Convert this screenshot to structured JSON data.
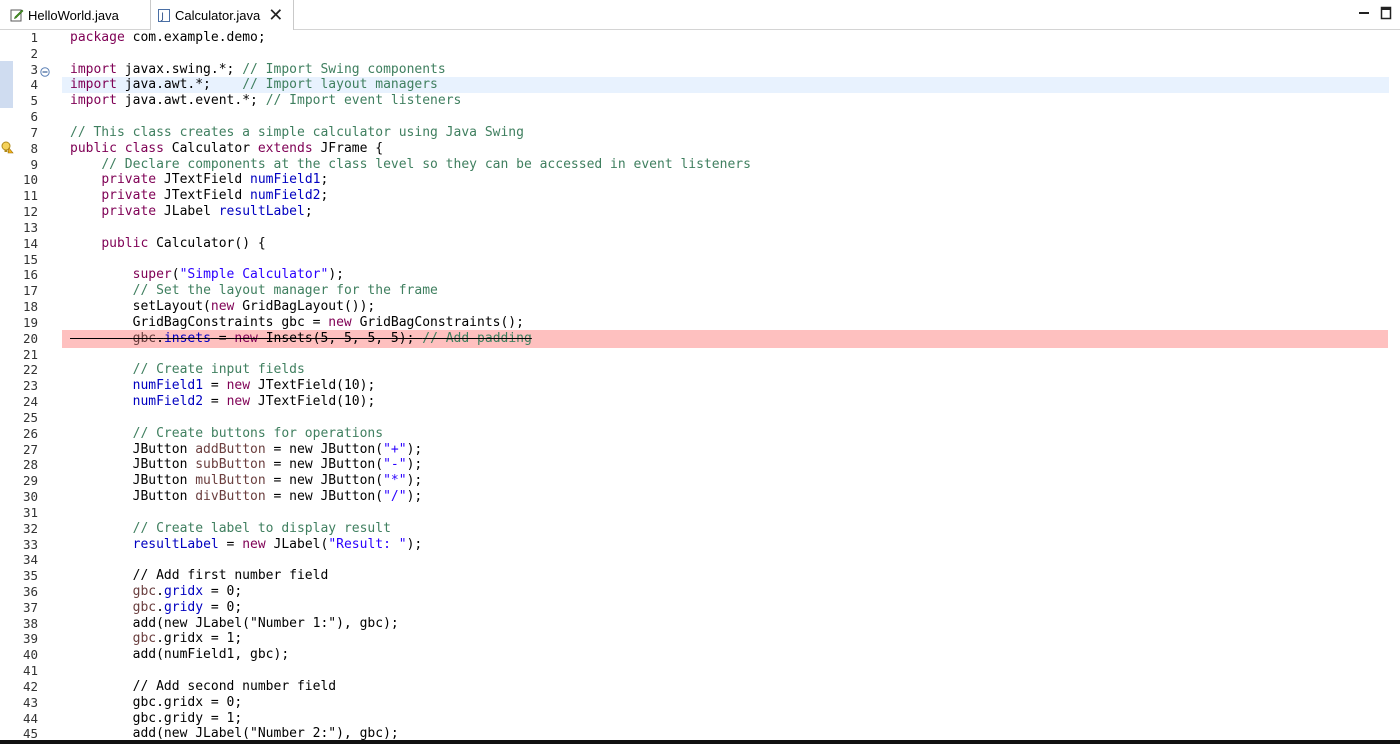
{
  "tabs": [
    {
      "label": "HelloWorld.java",
      "icon": "java-file-edit-icon",
      "active": false
    },
    {
      "label": "Calculator.java",
      "icon": "java-file-icon",
      "active": true
    }
  ],
  "colors": {
    "keyword": "#7f0055",
    "comment": "#3f7f5f",
    "string": "#2a00ff",
    "field": "#0000c0",
    "local": "#6a3e3e",
    "current_line": "#e8f2fe",
    "deleted_line": "#fec0bf"
  },
  "editor": {
    "line_numbers": [
      "1",
      "2",
      "3",
      "4",
      "5",
      "6",
      "7",
      "8",
      "9",
      "10",
      "11",
      "12",
      "13",
      "14",
      "15",
      "16",
      "17",
      "18",
      "19",
      "20",
      "21",
      "22",
      "23",
      "24",
      "25",
      "26",
      "27",
      "28",
      "29",
      "30",
      "31",
      "32",
      "33",
      "34",
      "35",
      "36",
      "37",
      "38",
      "39",
      "40",
      "41",
      "42",
      "43",
      "44",
      "45"
    ],
    "lines": [
      [
        [
          "kw",
          "package"
        ],
        [
          "p",
          " com.example.demo;"
        ]
      ],
      [],
      [
        [
          "kw",
          "import"
        ],
        [
          "p",
          " javax.swing.*; "
        ],
        [
          "cm",
          "// Import Swing components"
        ]
      ],
      [
        [
          "kw",
          "import"
        ],
        [
          "p",
          " java.awt.*;    "
        ],
        [
          "cm",
          "// Import layout managers"
        ]
      ],
      [
        [
          "kw",
          "import"
        ],
        [
          "p",
          " java.awt.event.*; "
        ],
        [
          "cm",
          "// Import event listeners"
        ]
      ],
      [],
      [
        [
          "cm",
          "// This class creates a simple calculator using Java Swing"
        ]
      ],
      [
        [
          "kw",
          "public"
        ],
        [
          "p",
          " "
        ],
        [
          "kw",
          "class"
        ],
        [
          "p",
          " Calculator "
        ],
        [
          "kw",
          "extends"
        ],
        [
          "p",
          " JFrame {"
        ]
      ],
      [
        [
          "p",
          "    "
        ],
        [
          "cm",
          "// Declare components at the class level so they can be accessed in event listeners"
        ]
      ],
      [
        [
          "p",
          "    "
        ],
        [
          "kw",
          "private"
        ],
        [
          "p",
          " JTextField "
        ],
        [
          "fd",
          "numField1"
        ],
        [
          "p",
          ";"
        ]
      ],
      [
        [
          "p",
          "    "
        ],
        [
          "kw",
          "private"
        ],
        [
          "p",
          " JTextField "
        ],
        [
          "fd",
          "numField2"
        ],
        [
          "p",
          ";"
        ]
      ],
      [
        [
          "p",
          "    "
        ],
        [
          "kw",
          "private"
        ],
        [
          "p",
          " JLabel "
        ],
        [
          "fd",
          "resultLabel"
        ],
        [
          "p",
          ";"
        ]
      ],
      [],
      [
        [
          "p",
          "    "
        ],
        [
          "kw",
          "public"
        ],
        [
          "p",
          " Calculator() {"
        ]
      ],
      [],
      [
        [
          "p",
          "        "
        ],
        [
          "kw",
          "super"
        ],
        [
          "p",
          "("
        ],
        [
          "st",
          "\"Simple Calculator\""
        ],
        [
          "p",
          ");"
        ]
      ],
      [
        [
          "p",
          "        "
        ],
        [
          "cm",
          "// Set the layout manager for the frame"
        ]
      ],
      [
        [
          "p",
          "        setLayout("
        ],
        [
          "kw",
          "new"
        ],
        [
          "p",
          " GridBagLayout());"
        ]
      ],
      [
        [
          "p",
          "        GridBagConstraints gbc = "
        ],
        [
          "kw",
          "new"
        ],
        [
          "p",
          " GridBagConstraints();"
        ]
      ],
      [
        [
          "p",
          "        "
        ],
        [
          "lv",
          "gbc"
        ],
        [
          "p",
          "."
        ],
        [
          "fd",
          "insets"
        ],
        [
          "p",
          " = "
        ],
        [
          "kw",
          "new"
        ],
        [
          "p",
          " Insets(5, 5, 5, 5); "
        ],
        [
          "cm",
          "// Add padding"
        ]
      ],
      [],
      [
        [
          "p",
          "        "
        ],
        [
          "cm",
          "// Create input fields"
        ]
      ],
      [
        [
          "p",
          "        "
        ],
        [
          "fd",
          "numField1"
        ],
        [
          "p",
          " = "
        ],
        [
          "kw",
          "new"
        ],
        [
          "p",
          " JTextField(10);"
        ]
      ],
      [
        [
          "p",
          "        "
        ],
        [
          "fd",
          "numField2"
        ],
        [
          "p",
          " = "
        ],
        [
          "kw",
          "new"
        ],
        [
          "p",
          " JTextField(10);"
        ]
      ],
      [],
      [
        [
          "p",
          "        "
        ],
        [
          "cm",
          "// Create buttons for operations"
        ]
      ],
      [
        [
          "p",
          "        JButton "
        ],
        [
          "lv",
          "addButton"
        ],
        [
          "p",
          " = new JButton("
        ],
        [
          "st",
          "\"+\""
        ],
        [
          "p",
          ");"
        ]
      ],
      [
        [
          "p",
          "        JButton "
        ],
        [
          "lv",
          "subButton"
        ],
        [
          "p",
          " = new JButton("
        ],
        [
          "st",
          "\"-\""
        ],
        [
          "p",
          ");"
        ]
      ],
      [
        [
          "p",
          "        JButton "
        ],
        [
          "lv",
          "mulButton"
        ],
        [
          "p",
          " = new JButton("
        ],
        [
          "st",
          "\"*\""
        ],
        [
          "p",
          ");"
        ]
      ],
      [
        [
          "p",
          "        JButton "
        ],
        [
          "lv",
          "divButton"
        ],
        [
          "p",
          " = new JButton("
        ],
        [
          "st",
          "\"/\""
        ],
        [
          "p",
          ");"
        ]
      ],
      [],
      [
        [
          "p",
          "        "
        ],
        [
          "cm",
          "// Create label to display result"
        ]
      ],
      [
        [
          "p",
          "        "
        ],
        [
          "fd",
          "resultLabel"
        ],
        [
          "p",
          " = "
        ],
        [
          "kw",
          "new"
        ],
        [
          "p",
          " JLabel("
        ],
        [
          "st",
          "\"Result: \""
        ],
        [
          "p",
          ");"
        ]
      ],
      [],
      [
        [
          "p",
          "        // Add first number field"
        ]
      ],
      [
        [
          "p",
          "        "
        ],
        [
          "lv",
          "gbc"
        ],
        [
          "p",
          "."
        ],
        [
          "fd",
          "gridx"
        ],
        [
          "p",
          " = 0;"
        ]
      ],
      [
        [
          "p",
          "        "
        ],
        [
          "lv",
          "gbc"
        ],
        [
          "p",
          "."
        ],
        [
          "fd",
          "gridy"
        ],
        [
          "p",
          " = 0;"
        ]
      ],
      [
        [
          "p",
          "        add(new JLabel(\"Number 1:\"), gbc);"
        ]
      ],
      [
        [
          "p",
          "        "
        ],
        [
          "lv",
          "gbc"
        ],
        [
          "p",
          ".gridx = 1;"
        ]
      ],
      [
        [
          "p",
          "        add(numField1, gbc);"
        ]
      ],
      [],
      [
        [
          "p",
          "        // Add second number field"
        ]
      ],
      [
        [
          "p",
          "        gbc.gridx = 0;"
        ]
      ],
      [
        [
          "p",
          "        gbc.gridy = 1;"
        ]
      ],
      [
        [
          "p",
          "        add(new JLabel(\"Number 2:\"), gbc);"
        ]
      ]
    ]
  }
}
